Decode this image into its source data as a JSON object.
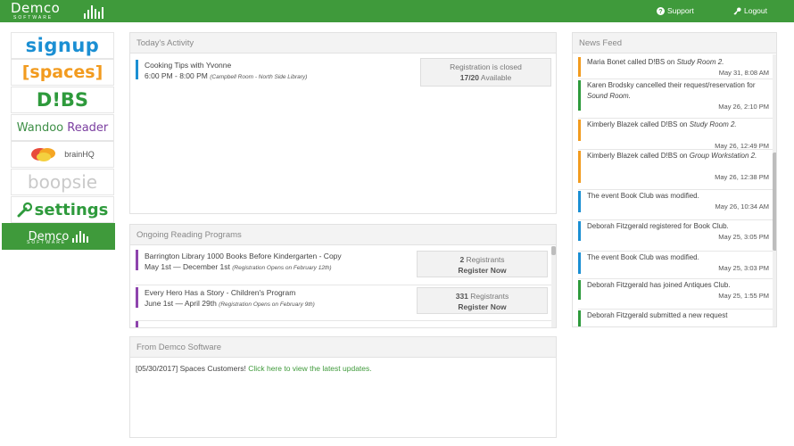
{
  "header": {
    "logo_main": "Demco",
    "logo_sub": "SOFTWARE",
    "support_label": "Support",
    "logout_label": "Logout",
    "brand_color": "#3f9a3b"
  },
  "sidebar": {
    "items": [
      {
        "label": "signup",
        "icon": "signup-logo"
      },
      {
        "label": "[spaces]",
        "icon": "spaces-logo"
      },
      {
        "label": "D!BS",
        "icon": "dibs-logo"
      },
      {
        "label_a": "Wandoo",
        "label_b": "Reader",
        "icon": "wandoo-reader-logo"
      },
      {
        "label": "brainHQ",
        "icon": "brainhq-logo"
      },
      {
        "label": "boopsie",
        "icon": "boopsie-logo"
      },
      {
        "label": "settings",
        "icon": "wrench-icon"
      },
      {
        "label": "Demco",
        "sub": "SOFTWARE",
        "icon": "demco-logo"
      }
    ]
  },
  "activity": {
    "title": "Today's Activity",
    "items": [
      {
        "name": "Cooking Tips with Yvonne",
        "time": "6:00 PM - 8:00 PM",
        "location": "(Campbell Room - North Side Library)",
        "status": "Registration is closed",
        "count": "17/20",
        "count_suffix": "Available",
        "accent": "#1b8fd3"
      }
    ]
  },
  "reading": {
    "title": "Ongoing Reading Programs",
    "items": [
      {
        "name": "Barrington Library 1000 Books Before Kindergarten - Copy",
        "dates": "May 1st — December 1st",
        "note": "(Registration Opens on February 12th)",
        "registrants": "2",
        "registrants_label": "Registrants",
        "action": "Register Now",
        "accent": "#8e44ad"
      },
      {
        "name": "Every Hero Has a Story - Children's Program",
        "dates": "June 1st — April 29th",
        "note": "(Registration Opens on February 9th)",
        "registrants": "331",
        "registrants_label": "Registrants",
        "action": "Register Now",
        "accent": "#8e44ad"
      }
    ]
  },
  "demco_news": {
    "title": "From Demco Software",
    "date": "[05/30/2017]",
    "text": "Spaces Customers!",
    "link": "Click here to view the latest updates."
  },
  "news_feed": {
    "title": "News Feed",
    "items": [
      {
        "text_a": "Maria Bonet called D!BS on ",
        "em": "Study Room 2.",
        "text_b": "",
        "date": "May 31, 8:08 AM",
        "accent": "#f29b1f"
      },
      {
        "text_a": "Karen Brodsky cancelled their request/reservation for ",
        "em": "Sound Room.",
        "text_b": "",
        "date": "May 26, 2:10 PM",
        "accent": "#2e9a3c"
      },
      {
        "text_a": "Kimberly Blazek called D!BS on ",
        "em": "Study Room 2.",
        "text_b": "",
        "date": "May 26, 12:49 PM",
        "accent": "#f29b1f"
      },
      {
        "text_a": "Kimberly Blazek called D!BS on ",
        "em": "Group Workstation 2.",
        "text_b": "",
        "date": "May 26, 12:38 PM",
        "accent": "#f29b1f"
      },
      {
        "text_a": "The event Book Club was modified.",
        "em": "",
        "text_b": "",
        "date": "May 26, 10:34 AM",
        "accent": "#1b8fd3"
      },
      {
        "text_a": "Deborah Fitzgerald registered for Book Club.",
        "em": "",
        "text_b": "",
        "date": "May 25, 3:05 PM",
        "accent": "#1b8fd3"
      },
      {
        "text_a": "The event Book Club was modified.",
        "em": "",
        "text_b": "",
        "date": "May 25, 3:03 PM",
        "accent": "#1b8fd3"
      },
      {
        "text_a": "Deborah Fitzgerald has joined Antiques Club.",
        "em": "",
        "text_b": "",
        "date": "May 25, 1:55 PM",
        "accent": "#2e9a3c"
      },
      {
        "text_a": "Deborah Fitzgerald submitted a new request",
        "em": "",
        "text_b": "",
        "date": "",
        "accent": "#2e9a3c"
      }
    ]
  }
}
